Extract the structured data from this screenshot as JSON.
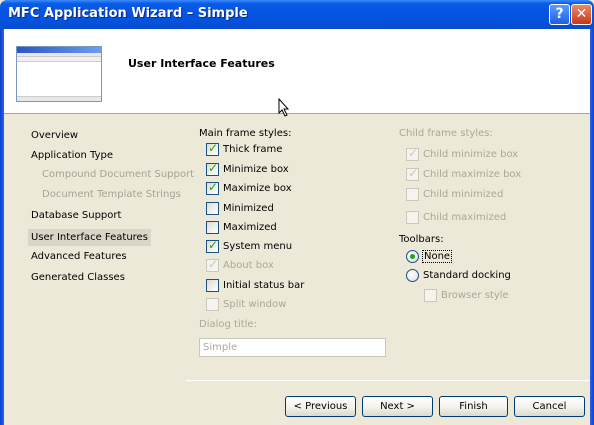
{
  "window": {
    "title": "MFC Application Wizard – Simple",
    "help": "?",
    "close": "✕"
  },
  "header": {
    "title": "User Interface Features"
  },
  "nav": {
    "items": [
      {
        "label": "Overview",
        "sub": false,
        "selected": false
      },
      {
        "label": "Application Type",
        "sub": false,
        "selected": false
      },
      {
        "label": "Compound Document Support",
        "sub": true,
        "selected": false
      },
      {
        "label": "Document Template Strings",
        "sub": true,
        "selected": false
      },
      {
        "label": "Database Support",
        "sub": false,
        "selected": false
      },
      {
        "label": "User Interface Features",
        "sub": false,
        "selected": true
      },
      {
        "label": "Advanced Features",
        "sub": false,
        "selected": false
      },
      {
        "label": "Generated Classes",
        "sub": false,
        "selected": false
      }
    ]
  },
  "main_frame": {
    "label": "Main frame styles:",
    "options": [
      {
        "label": "Thick frame",
        "checked": true,
        "enabled": true
      },
      {
        "label": "Minimize box",
        "checked": true,
        "enabled": true
      },
      {
        "label": "Maximize box",
        "checked": true,
        "enabled": true
      },
      {
        "label": "Minimized",
        "checked": false,
        "enabled": true
      },
      {
        "label": "Maximized",
        "checked": false,
        "enabled": true
      },
      {
        "label": "System menu",
        "checked": true,
        "enabled": true
      },
      {
        "label": "About box",
        "checked": true,
        "enabled": false
      },
      {
        "label": "Initial status bar",
        "checked": false,
        "enabled": true
      },
      {
        "label": "Split window",
        "checked": false,
        "enabled": false
      }
    ]
  },
  "child_frame": {
    "label": "Child frame styles:",
    "options": [
      {
        "label": "Child minimize box",
        "checked": true,
        "enabled": false
      },
      {
        "label": "Child maximize box",
        "checked": true,
        "enabled": false
      },
      {
        "label": "Child minimized",
        "checked": false,
        "enabled": false
      },
      {
        "label": "Child maximized",
        "checked": false,
        "enabled": false
      }
    ]
  },
  "toolbars": {
    "label": "Toolbars:",
    "none": "None",
    "docking": "Standard docking",
    "browser": "Browser style",
    "selected": "None"
  },
  "dialog_title": {
    "label": "Dialog title:",
    "value": "Simple"
  },
  "buttons": {
    "previous": "< Previous",
    "next": "Next >",
    "finish": "Finish",
    "cancel": "Cancel"
  }
}
